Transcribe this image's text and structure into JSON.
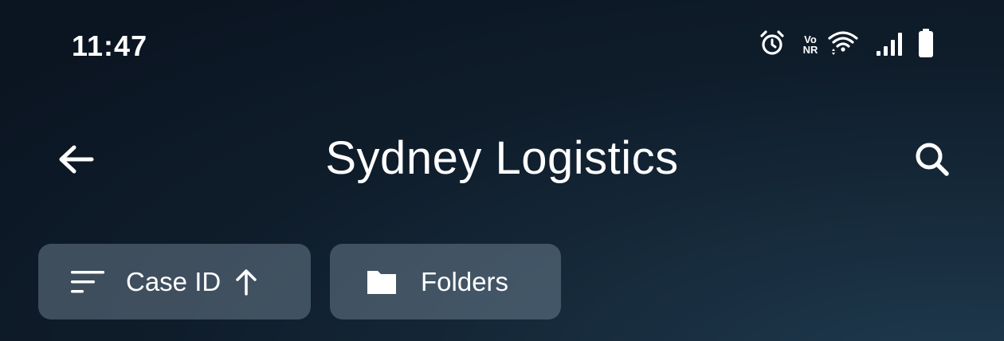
{
  "status_bar": {
    "time": "11:47",
    "vonr_top": "Vo",
    "vonr_bottom": "NR",
    "icons": [
      "alarm-icon",
      "vonr-icon",
      "wifi-icon",
      "signal-icon",
      "battery-icon"
    ]
  },
  "app_bar": {
    "title": "Sydney Logistics",
    "back_icon": "arrow-left-icon",
    "search_icon": "search-icon"
  },
  "chips": {
    "sort": {
      "label": "Case ID",
      "icon": "sort-lines-icon",
      "direction_icon": "arrow-up-icon"
    },
    "folders": {
      "label": "Folders",
      "icon": "folder-icon"
    }
  },
  "colors": {
    "background_dark": "#0b1522",
    "background_light": "#1f3a4e",
    "chip_background": "#4a5a6a",
    "text": "#ffffff"
  }
}
